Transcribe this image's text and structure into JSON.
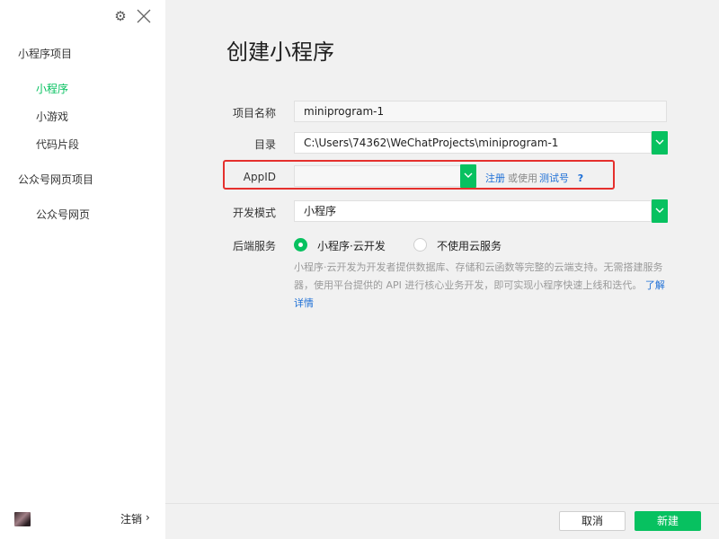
{
  "sidebar": {
    "groups": [
      {
        "label": "小程序项目",
        "items": [
          {
            "label": "小程序",
            "active": true
          },
          {
            "label": "小游戏",
            "active": false
          },
          {
            "label": "代码片段",
            "active": false
          }
        ]
      },
      {
        "label": "公众号网页项目",
        "items": [
          {
            "label": "公众号网页",
            "active": false
          }
        ]
      }
    ],
    "logout_label": "注销",
    "logout_chevron": "›",
    "settings_icon": "⚙"
  },
  "main": {
    "title": "创建小程序",
    "form": {
      "project_name": {
        "label": "项目名称",
        "value": "miniprogram-1"
      },
      "directory": {
        "label": "目录",
        "value": "C:\\Users\\74362\\WeChatProjects\\miniprogram-1"
      },
      "appid": {
        "label": "AppID",
        "value": "",
        "register_link": "注册",
        "or_use": "或使用",
        "test_account_link": "测试号",
        "help": "?"
      },
      "dev_mode": {
        "label": "开发模式",
        "value": "小程序"
      },
      "backend": {
        "label": "后端服务",
        "options": [
          {
            "label": "小程序·云开发",
            "selected": true
          },
          {
            "label": "不使用云服务",
            "selected": false
          }
        ],
        "description": "小程序·云开发为开发者提供数据库、存储和云函数等完整的云端支持。无需搭建服务器，使用平台提供的 API 进行核心业务开发，即可实现小程序快速上线和迭代。",
        "learn_more": "了解详情"
      }
    }
  },
  "footer": {
    "cancel_label": "取消",
    "create_label": "新建"
  },
  "colors": {
    "accent": "#07c160",
    "link": "#1d6fd6",
    "highlight": "#e5302d"
  }
}
